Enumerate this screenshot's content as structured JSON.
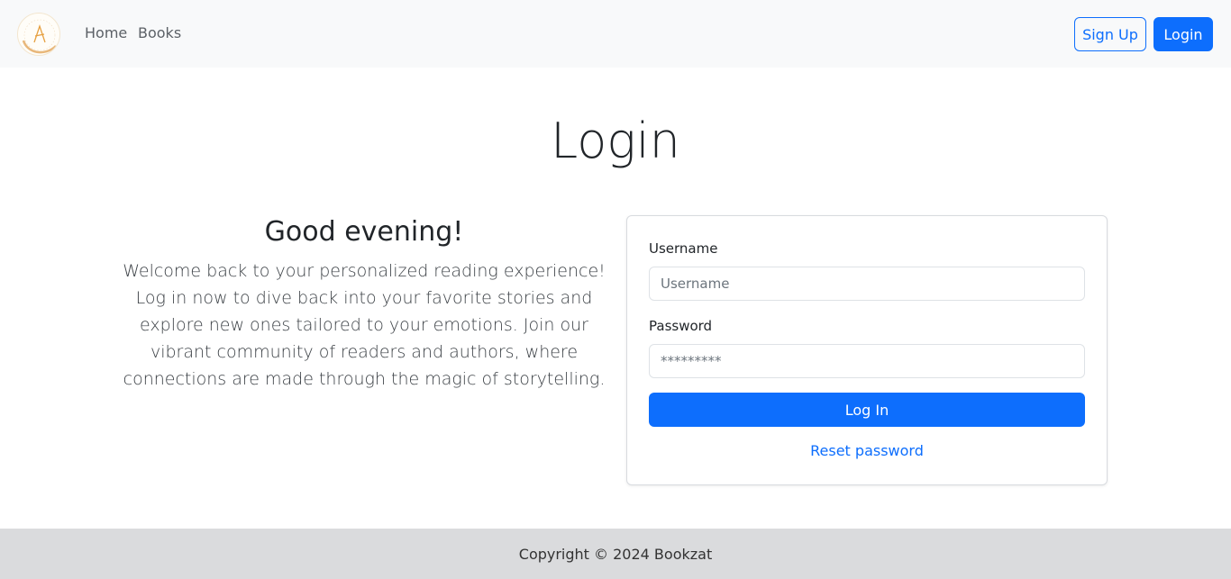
{
  "nav": {
    "logo_icon": "bookzat-logo",
    "home_label": "Home",
    "books_label": "Books",
    "signup_label": "Sign Up",
    "login_label": "Login"
  },
  "page": {
    "title": "Login"
  },
  "intro": {
    "greeting": "Good evening!",
    "text": "Welcome back to your personalized reading experience! Log in now to dive back into your favorite stories and explore new ones tailored to your emotions. Join our vibrant community of readers and authors, where connections are made through the magic of storytelling."
  },
  "form": {
    "username_label": "Username",
    "username_placeholder": "Username",
    "username_value": "",
    "password_label": "Password",
    "password_placeholder": "*********",
    "password_value": "",
    "submit_label": "Log In",
    "reset_label": "Reset password"
  },
  "footer": {
    "text": "Copyright © 2024 Bookzat"
  },
  "colors": {
    "primary": "#0d6efd",
    "navbar_bg": "#f8f9fa",
    "footer_bg": "#dadbdd"
  }
}
